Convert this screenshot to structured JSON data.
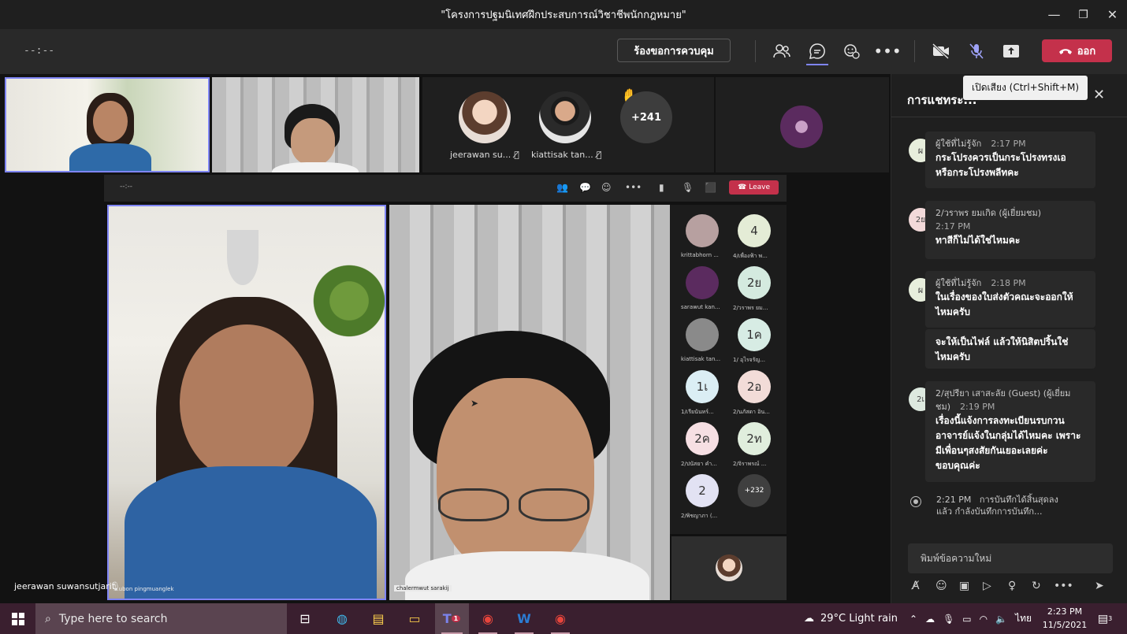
{
  "window": {
    "title": "\"โครงการปฐมนิเทศฝึกประสบการณ์วิชาชีพนักกฎหมาย\"",
    "minimize": "—",
    "maximize": "❐",
    "close": "✕"
  },
  "toolbar": {
    "timer": "--:--",
    "request_control": "ร้องขอการควบคุม",
    "leave": "ออก",
    "tooltip": "เปิดเสียง (Ctrl+Shift+M)",
    "accent": "#7f85f5",
    "leave_color": "#c4314b"
  },
  "stage": {
    "participants": [
      {
        "name": "jeerawan su...",
        "muted": true
      },
      {
        "name": "kiattisak tan...",
        "muted": true
      }
    ],
    "overflow_count": "+241",
    "hand_raised": "✋",
    "speaker_name": "jeerawan suwansutjarit"
  },
  "share": {
    "timer": "--:--",
    "leave": "Leave",
    "left_name": "...ubon pingmuanglek",
    "right_name": "chalermwut sarakij",
    "roster": [
      {
        "initials": "",
        "name": "krittabhorn ...",
        "color": "#b7a0a0"
      },
      {
        "initials": "4",
        "name": "4/เพื่องฟ้า พ...",
        "color": "#e4ecd6"
      },
      {
        "initials": "",
        "name": "sarawut kan...",
        "color": "#5b2b5f"
      },
      {
        "initials": "2ย",
        "name": "2/วราพร ยม...",
        "color": "#d4eadf"
      },
      {
        "initials": "",
        "name": "kiattisak tan...",
        "color": "#8a8a8a"
      },
      {
        "initials": "1ค",
        "name": "1/ อุไรจรัญ...",
        "color": "#d7ece4"
      },
      {
        "initials": "1เ",
        "name": "1/เรียนันทร์...",
        "color": "#dbeef4"
      },
      {
        "initials": "2อ",
        "name": "2/นภัสดา อิน...",
        "color": "#f2dcd8"
      },
      {
        "initials": "2ค",
        "name": "2/ปนัสยา คำ...",
        "color": "#f6dfe3"
      },
      {
        "initials": "2ท",
        "name": "2/จิราพรณ์ ...",
        "color": "#e0eedd"
      },
      {
        "initials": "2",
        "name": "2/พิชญาภา (...",
        "color": "#e2e2f3"
      },
      {
        "initials": "+232",
        "name": "",
        "color": "#3f3f3f"
      }
    ]
  },
  "chat": {
    "title": "การแชทระ...",
    "messages": [
      {
        "initial": "ผ",
        "avatar_color": "#e7eedc",
        "sender": "ผู้ใช้ที่ไม่รู้จัก",
        "time": "2:17 PM",
        "lines": [
          "กระโปรงควรเป็นกระโปรงทรงเอ",
          "หรือกระโปรงพลีทคะ"
        ]
      },
      {
        "initial": "2ย",
        "avatar_color": "#f2d9d9",
        "sender": "2/วราพร ยมเกิด (ผู้เยี่ยมชม)",
        "time": "2:17 PM",
        "lines": [
          "ทาสีก็ไม่ได้ใช่ไหมคะ"
        ]
      },
      {
        "initial": "ผ",
        "avatar_color": "#e7eedc",
        "sender": "ผู้ใช้ที่ไม่รู้จัก",
        "time": "2:18 PM",
        "lines": [
          "ในเรื่องของใบส่งตัวคณะจะออกให้",
          "ไหมครับ"
        ],
        "followup": [
          "จะให้เป็นไฟล์ แล้วให้นิสิตปริ้นใช่",
          "ไหมครับ"
        ]
      },
      {
        "initial": "2เ",
        "avatar_color": "#dde9df",
        "sender": "2/สุปรียา เสาสะลัย (Guest) (ผู้เยี่ยม",
        "sender2": "ชม)",
        "time": "2:19 PM",
        "lines": [
          "เรื่องนี้แจ้งการลงทะเบียนรบกวน",
          "อาจารย์แจ้งในกลุ่มได้ไหมคะ เพราะ",
          "มีเพื่อนๆสงสัยกันเยอะเลยค่ะ",
          "ขอบคุณค่ะ"
        ]
      }
    ],
    "system_time": "2:21 PM",
    "system_text": "การบันทึกได้สิ้นสุดลง",
    "system_text2": "แล้ว กำลังบันทึกการบันทึก...",
    "compose_placeholder": "พิมพ์ข้อความใหม่"
  },
  "taskbar": {
    "search_placeholder": "Type here to search",
    "weather": "29°C  Light rain",
    "language": "ไทย",
    "time": "2:23 PM",
    "date": "11/5/2021",
    "notification_count": "3",
    "teams_badge": "1"
  }
}
